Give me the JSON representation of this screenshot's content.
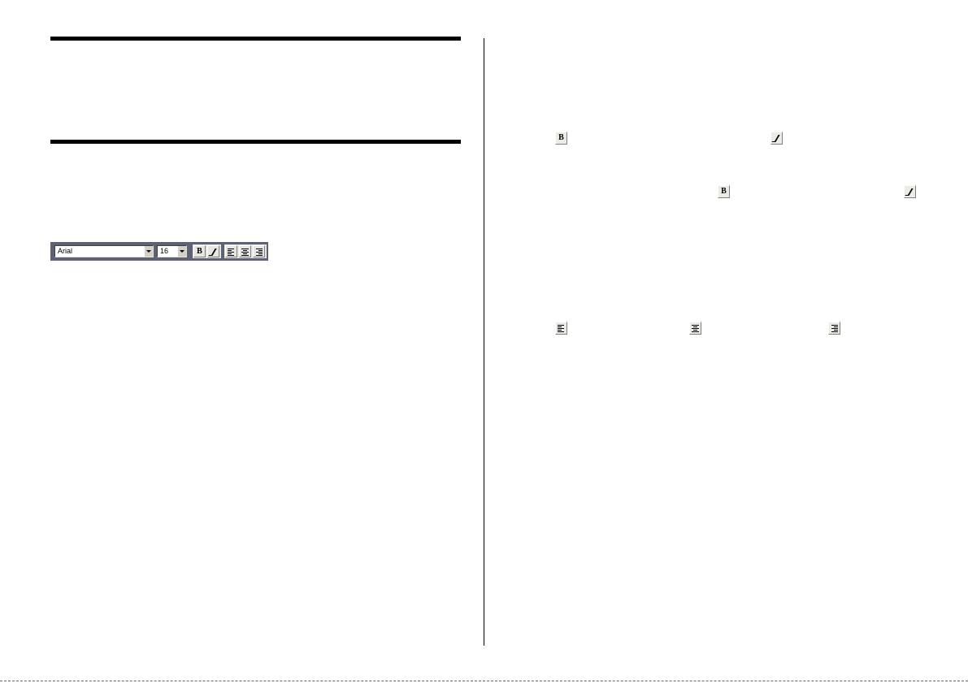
{
  "toolbar": {
    "font_value": "Arial",
    "size_value": "16",
    "bold_label": "B"
  },
  "icons": {
    "bold_label": "B"
  }
}
